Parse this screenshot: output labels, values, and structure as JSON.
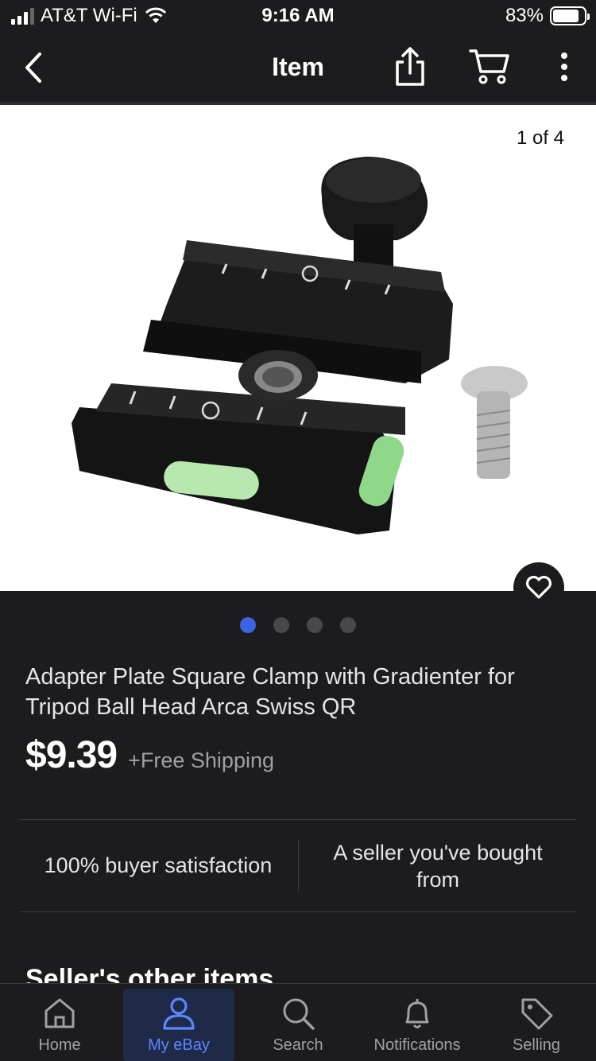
{
  "status_bar": {
    "carrier": "AT&T Wi-Fi",
    "time": "9:16 AM",
    "battery": "83%",
    "battery_level": 0.83
  },
  "nav": {
    "title": "Item",
    "icons": [
      "back-icon",
      "share-icon",
      "cart-icon",
      "more-icon"
    ]
  },
  "gallery": {
    "counter": "1 of 4",
    "total_images": 4,
    "active_index": 0
  },
  "item": {
    "title": "Adapter Plate Square Clamp with Gradienter for Tripod Ball Head Arca Swiss QR",
    "price": "$9.39",
    "shipping": "+Free Shipping"
  },
  "seller": {
    "satisfaction": "100% buyer satisfaction",
    "relationship": "A seller you've bought from"
  },
  "section": {
    "heading": "Seller's other items"
  },
  "tabs": [
    {
      "label": "Home",
      "icon": "home-icon"
    },
    {
      "label": "My eBay",
      "icon": "person-icon",
      "active": true
    },
    {
      "label": "Search",
      "icon": "search-icon"
    },
    {
      "label": "Notifications",
      "icon": "bell-icon"
    },
    {
      "label": "Selling",
      "icon": "tag-icon"
    }
  ],
  "colors": {
    "background": "#1c1c1e",
    "accent": "#3b63e6",
    "active_tab_bg": "#1e2a47",
    "active_tab_text": "#5b86ff"
  }
}
